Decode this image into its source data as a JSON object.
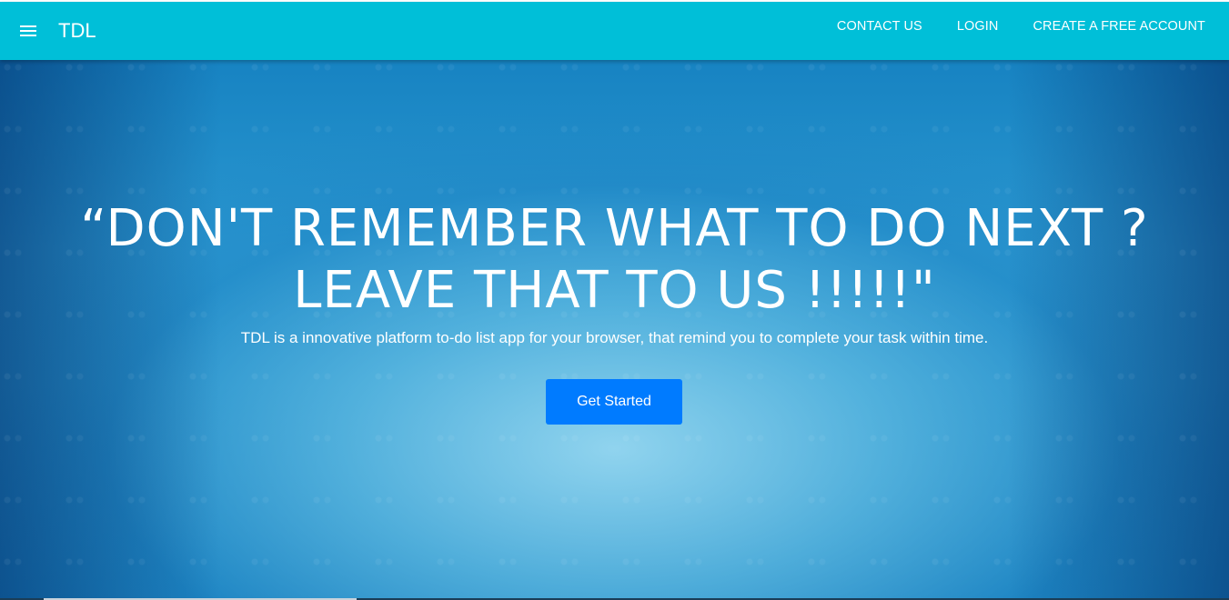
{
  "navbar": {
    "brand": "TDL",
    "links": [
      {
        "label": "CONTACT US"
      },
      {
        "label": "LOGIN"
      },
      {
        "label": "CREATE A FREE ACCOUNT"
      }
    ]
  },
  "hero": {
    "headline_line1": "“DON'T REMEMBER WHAT TO DO NEXT ?",
    "headline_line2": "LEAVE THAT TO US !!!!!\"",
    "subtext": "TDL is a innovative platform to-do list app for your browser, that remind you to complete your task within time.",
    "cta_label": "Get Started"
  },
  "icons": {
    "menu": "hamburger-menu-icon"
  },
  "colors": {
    "navbar": "#00bfd8",
    "cta": "#007bff",
    "hero": "#2a97d0"
  }
}
